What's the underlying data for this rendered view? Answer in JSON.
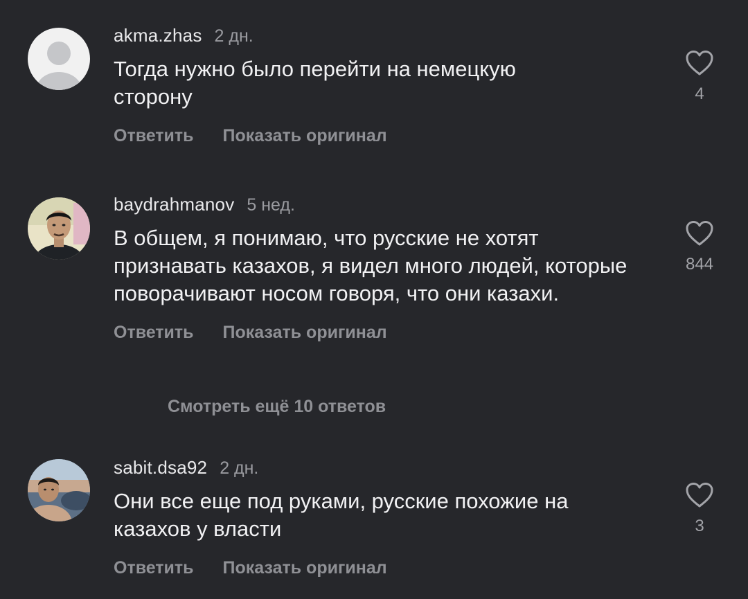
{
  "comments": [
    {
      "username": "akma.zhas",
      "time": "2 дн.",
      "text": "Тогда нужно было перейти на немецкую сторону",
      "reply_label": "Ответить",
      "show_original_label": "Показать оригинал",
      "likes": "4",
      "avatar_icon": "default-user-avatar"
    },
    {
      "username": "baydrahmanov",
      "time": "5 нед.",
      "text": "В общем, я понимаю, что русские не хотят признавать казахов, я видел много людей, которые поворачивают носом говоря, что они казахи.",
      "reply_label": "Ответить",
      "show_original_label": "Показать оригинал",
      "likes": "844",
      "avatar_icon": "user-photo-avatar"
    },
    {
      "username": "sabit.dsa92",
      "time": "2 дн.",
      "text": "Они все еще под руками, русские похожие на казахов у власти",
      "reply_label": "Ответить",
      "show_original_label": "Показать оригинал",
      "likes": "3",
      "avatar_icon": "user-photo-avatar"
    }
  ],
  "more_replies_label": "Смотреть ещё 10 ответов",
  "colors": {
    "background": "#26272b",
    "text": "#f1f1f3",
    "muted": "#8f9095"
  },
  "icons": {
    "like": "heart-outline-icon"
  }
}
